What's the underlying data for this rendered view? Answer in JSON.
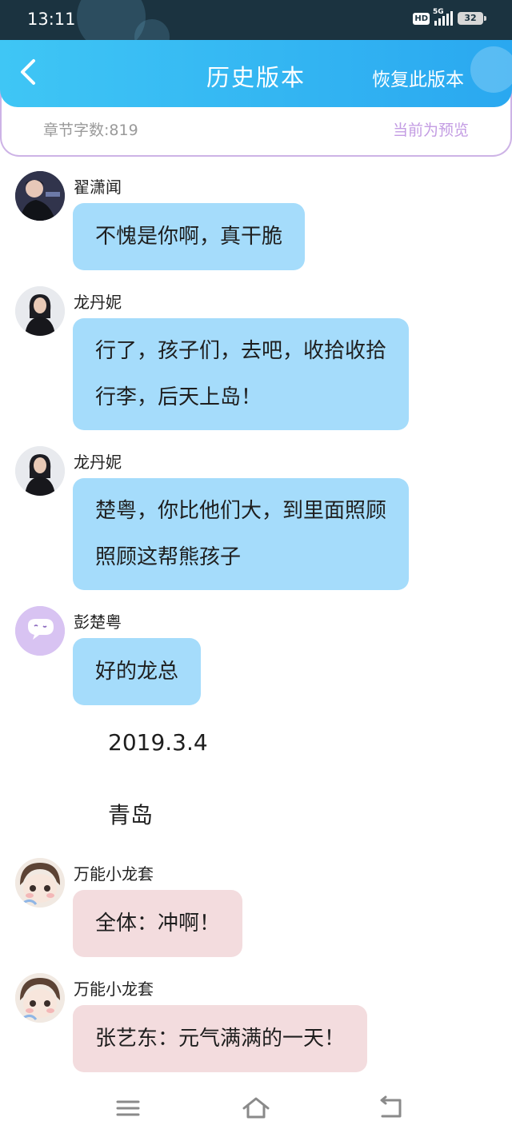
{
  "status_bar": {
    "time": "13:11",
    "hd_badge": "HD",
    "network": "5G",
    "battery": "32"
  },
  "header": {
    "title": "历史版本",
    "restore_label": "恢复此版本",
    "back_icon": "chevron-left-icon",
    "word_count": "章节字数:819",
    "preview_label": "当前为预览"
  },
  "messages": [
    {
      "sender": "翟潇闻",
      "text": "不愧是你啊，真干脆",
      "style": "blue"
    },
    {
      "sender": "龙丹妮",
      "lines": [
        "行了，孩子们，去吧，收拾收拾",
        "行李，后天上岛！"
      ],
      "style": "blue"
    },
    {
      "sender": "龙丹妮",
      "lines": [
        "楚粤，你比他们大，到里面照顾",
        "照顾这帮熊孩子"
      ],
      "style": "blue"
    },
    {
      "sender": "彭楚粤",
      "text": "好的龙总",
      "style": "blue"
    },
    {
      "sender": "万能小龙套",
      "text": "全体：冲啊！",
      "style": "pink"
    },
    {
      "sender": "万能小龙套",
      "text": "张艺东：元气满满的一天！",
      "style": "pink"
    }
  ],
  "narration": {
    "date": "2019.3.4",
    "place": "青岛"
  },
  "colors": {
    "title_bar": "#2aa8f0",
    "bubble_blue": "#a5dcfb",
    "bubble_pink": "#f3dcde",
    "preview_accent": "#c39ce3"
  },
  "nav": {
    "menu_icon": "menu-icon",
    "home_icon": "home-icon",
    "back_icon": "back-icon"
  }
}
